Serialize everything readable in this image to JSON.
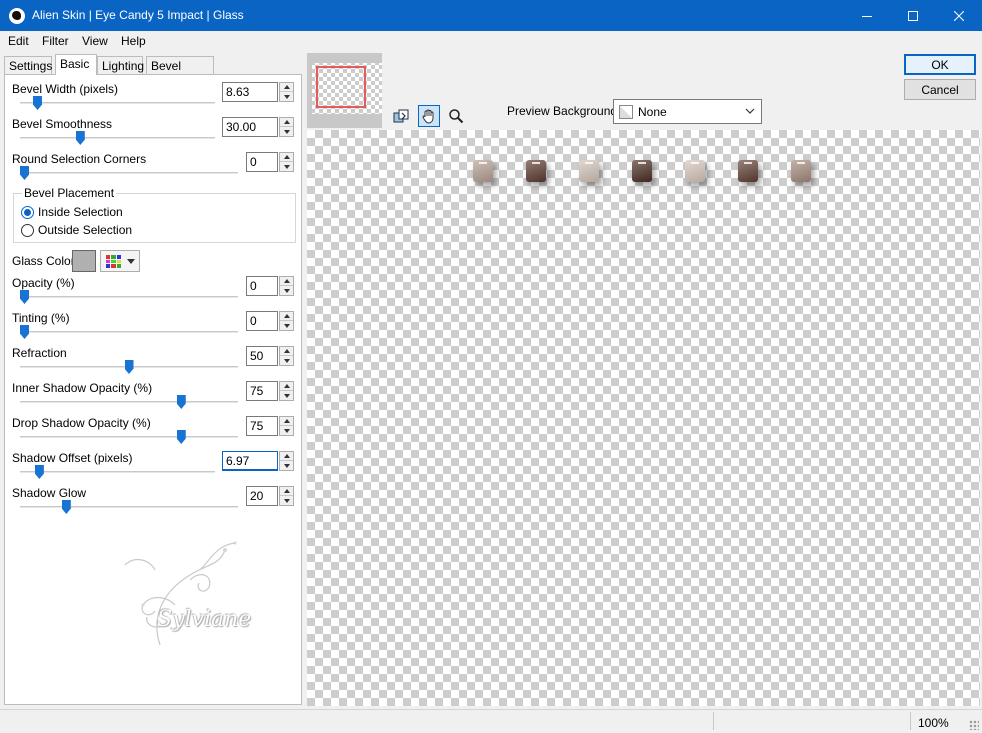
{
  "window": {
    "title": "Alien Skin | Eye Candy 5 Impact | Glass",
    "icon": "alien-skin-icon"
  },
  "menu": [
    "Edit",
    "Filter",
    "View",
    "Help"
  ],
  "tabs": [
    "Settings",
    "Basic",
    "Lighting",
    "Bevel Profile"
  ],
  "active_tab": "Basic",
  "controls": {
    "bevel_width": {
      "label": "Bevel Width (pixels)",
      "value": "8.63",
      "slider_fraction": 0.07
    },
    "bevel_smoothness": {
      "label": "Bevel Smoothness",
      "value": "30.00",
      "slider_fraction": 0.3
    },
    "round_corners": {
      "label": "Round Selection Corners",
      "value": "0",
      "slider_fraction": 0.0
    },
    "bevel_placement": {
      "legend": "Bevel Placement",
      "inside_label": "Inside Selection",
      "outside_label": "Outside Selection",
      "selected": "inside"
    },
    "glass_color": {
      "label": "Glass Color",
      "swatch": "#b0b0b0"
    },
    "opacity": {
      "label": "Opacity (%)",
      "value": "0",
      "slider_fraction": 0.0
    },
    "tinting": {
      "label": "Tinting (%)",
      "value": "0",
      "slider_fraction": 0.0
    },
    "refraction": {
      "label": "Refraction",
      "value": "50",
      "slider_fraction": 0.5
    },
    "inner_shadow_opacity": {
      "label": "Inner Shadow Opacity (%)",
      "value": "75",
      "slider_fraction": 0.75
    },
    "drop_shadow_opacity": {
      "label": "Drop Shadow Opacity (%)",
      "value": "75",
      "slider_fraction": 0.75
    },
    "shadow_offset": {
      "label": "Shadow Offset (pixels)",
      "value": "6.97",
      "slider_fraction": 0.08
    },
    "shadow_glow": {
      "label": "Shadow Glow",
      "value": "20",
      "slider_fraction": 0.2
    }
  },
  "watermark": {
    "text": "Sylviane"
  },
  "preview": {
    "background_label": "Preview Background:",
    "background_value": "None",
    "tile_colors": [
      "#b59f93",
      "#5b3a2e",
      "#d2c3b8",
      "#4a2c22",
      "#d6c6bb",
      "#5e3f32",
      "#a48a7c"
    ]
  },
  "buttons": {
    "ok": "OK",
    "cancel": "Cancel"
  },
  "status": {
    "zoom": "100%"
  },
  "colors": {
    "title_bar": "#0a64c4",
    "slider_thumb": "#1873d3",
    "selection_rect": "#e45b5b"
  }
}
